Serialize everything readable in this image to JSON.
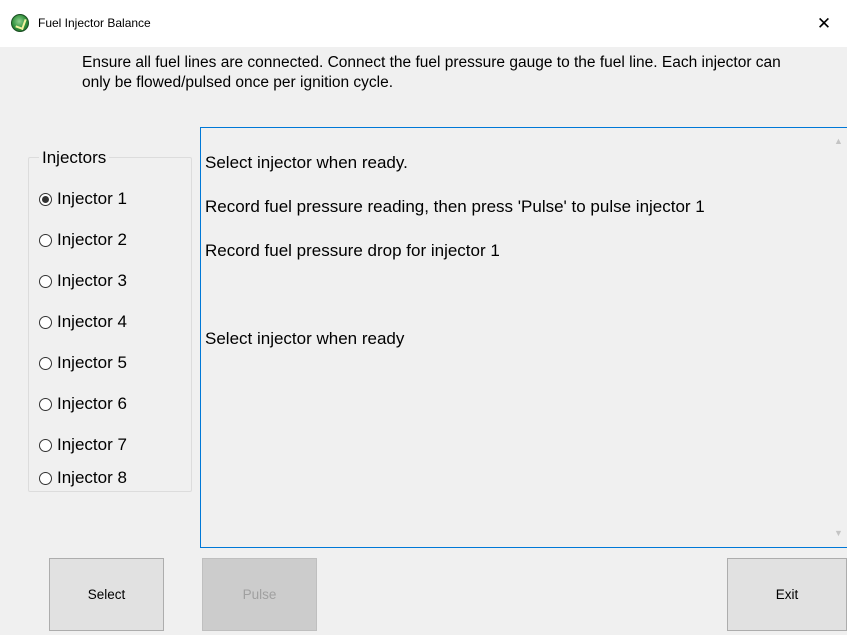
{
  "window": {
    "title": "Fuel Injector Balance",
    "close_glyph": "✕",
    "app_icon": "app-logo-icon"
  },
  "instructions": "Ensure all fuel lines are connected. Connect the fuel pressure gauge to the fuel line. Each injector can only be flowed/pulsed once per ignition cycle.",
  "injectors": {
    "group_label": "Injectors",
    "options": [
      {
        "label": "Injector 1",
        "checked": true
      },
      {
        "label": "Injector 2",
        "checked": false
      },
      {
        "label": "Injector 3",
        "checked": false
      },
      {
        "label": "Injector 4",
        "checked": false
      },
      {
        "label": "Injector 5",
        "checked": false
      },
      {
        "label": "Injector 6",
        "checked": false
      },
      {
        "label": "Injector 7",
        "checked": false
      },
      {
        "label": "Injector 8",
        "checked": false
      }
    ]
  },
  "log": {
    "lines": [
      "Select injector when ready.",
      "Record fuel pressure reading, then press 'Pulse' to pulse injector 1",
      "Record fuel pressure drop for injector 1",
      "",
      "Select injector when ready"
    ]
  },
  "buttons": {
    "select": {
      "label": "Select",
      "enabled": true
    },
    "pulse": {
      "label": "Pulse",
      "enabled": false
    },
    "exit": {
      "label": "Exit",
      "enabled": true
    }
  },
  "colors": {
    "focus_border": "#0078d7",
    "window_bg": "#f0f0f0",
    "button_bg": "#e1e1e1",
    "disabled_text": "#a0a0a0"
  }
}
